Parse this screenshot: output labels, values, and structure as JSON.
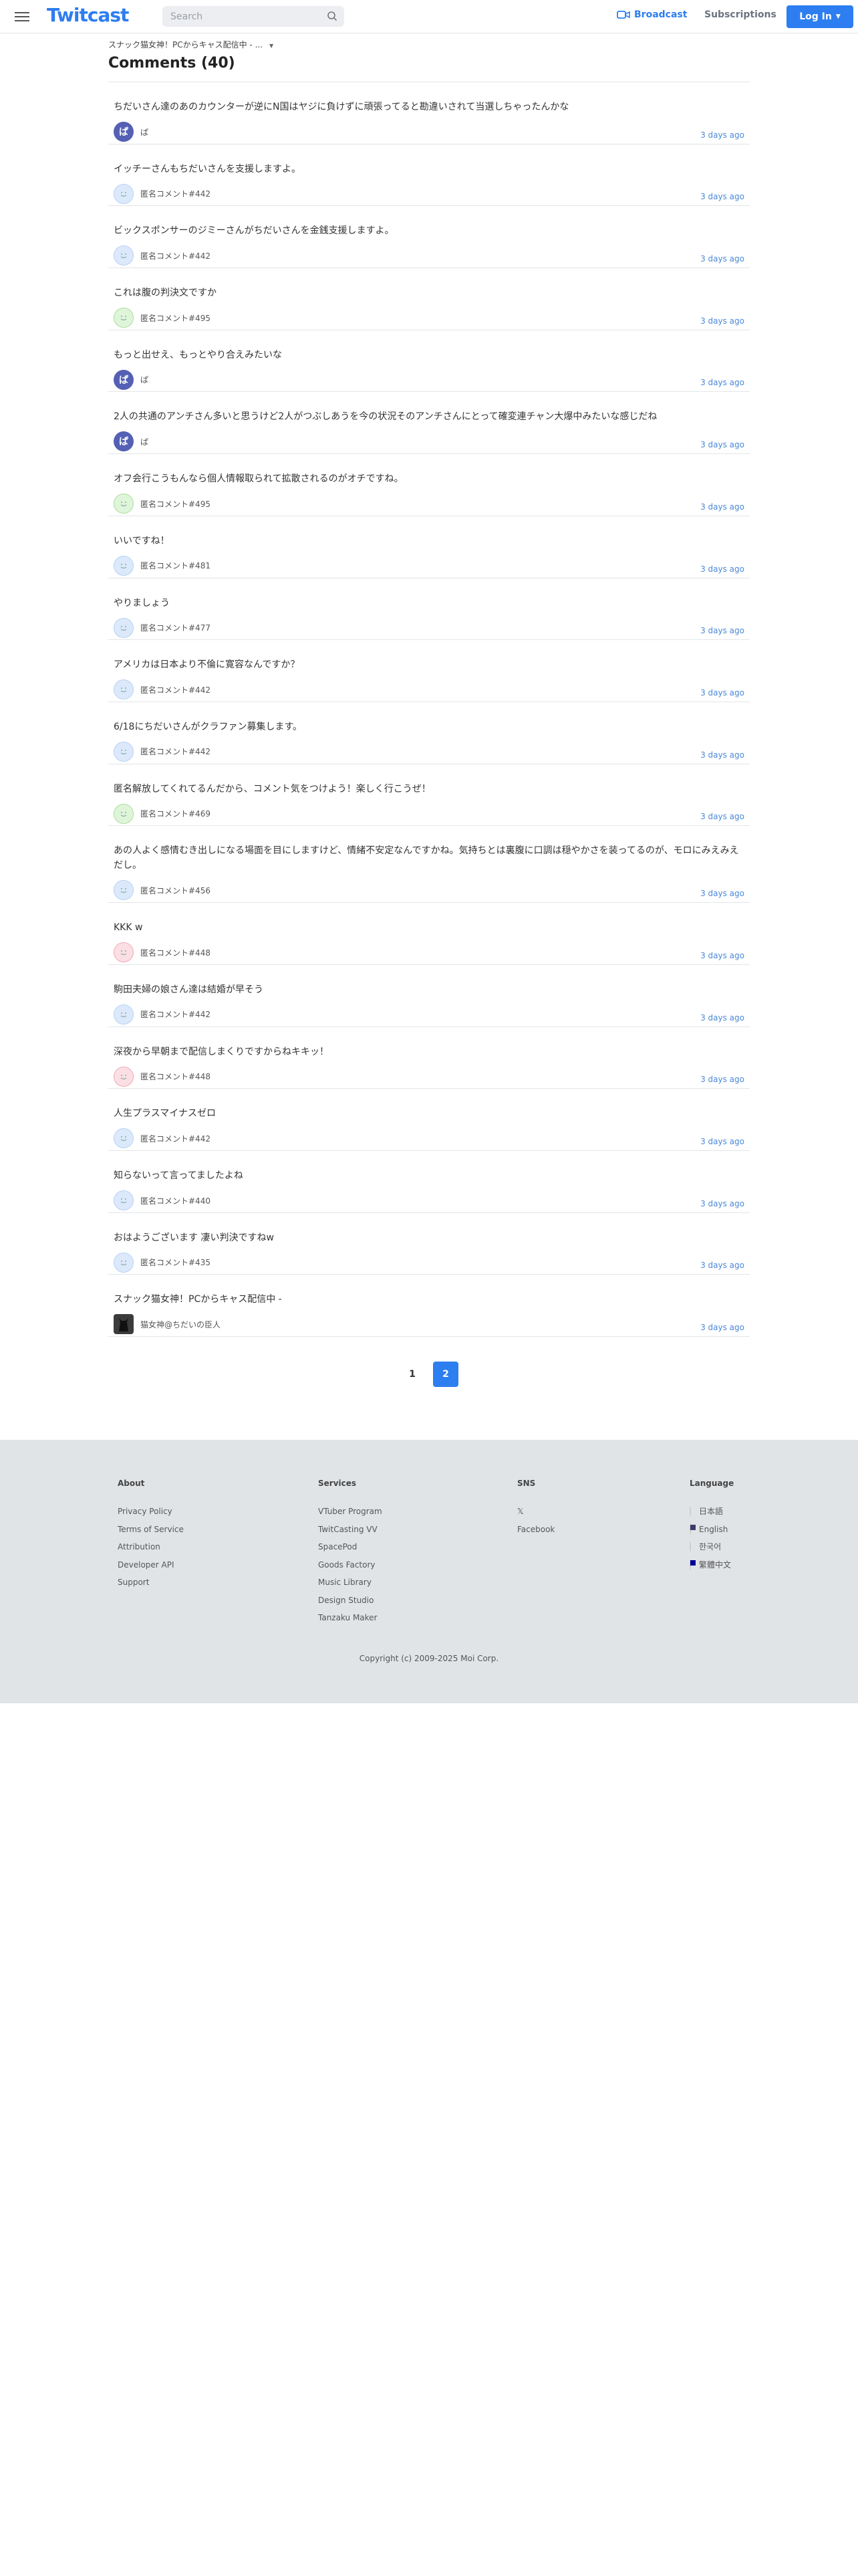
{
  "header": {
    "logo": "Twitcast",
    "search_placeholder": "Search",
    "broadcast_label": "Broadcast",
    "subscriptions_label": "Subscriptions",
    "login_label": "Log In"
  },
  "breadcrumb": "スナック猫女神！PCからキャス配信中 - ...",
  "page_title": "Comments (40)",
  "comments": [
    {
      "text": "ちだいさん達のあのカウンターが逆にN国はヤジに負けずに頑張ってると勘違いされて当選しちゃったんかな",
      "name": "ぱ",
      "time": "3 days ago",
      "avatar": "purple",
      "avatar_text": "ぱ"
    },
    {
      "text": "イッチーさんもちだいさんを支援しますよ。",
      "name": "匿名コメント#442",
      "time": "3 days ago",
      "avatar": "blue",
      "avatar_text": ""
    },
    {
      "text": "ビックスポンサーのジミーさんがちだいさんを金銭支援しますよ。",
      "name": "匿名コメント#442",
      "time": "3 days ago",
      "avatar": "blue",
      "avatar_text": ""
    },
    {
      "text": "これは腹の判決文ですか",
      "name": "匿名コメント#495",
      "time": "3 days ago",
      "avatar": "green",
      "avatar_text": ""
    },
    {
      "text": "もっと出せえ、もっとやり合えみたいな",
      "name": "ぱ",
      "time": "3 days ago",
      "avatar": "purple",
      "avatar_text": "ぱ"
    },
    {
      "text": "2人の共通のアンチさん多いと思うけど2人がつぶしあうを今の状況そのアンチさんにとって確変連チャン大爆中みたいな感じだね",
      "name": "ぱ",
      "time": "3 days ago",
      "avatar": "purple",
      "avatar_text": "ぱ"
    },
    {
      "text": "オフ会行こうもんなら個人情報取られて拡散されるのがオチですね。",
      "name": "匿名コメント#495",
      "time": "3 days ago",
      "avatar": "green",
      "avatar_text": ""
    },
    {
      "text": "いいですね！",
      "name": "匿名コメント#481",
      "time": "3 days ago",
      "avatar": "blue",
      "avatar_text": ""
    },
    {
      "text": "やりましょう",
      "name": "匿名コメント#477",
      "time": "3 days ago",
      "avatar": "blue",
      "avatar_text": ""
    },
    {
      "text": "アメリカは日本より不倫に寛容なんですか？",
      "name": "匿名コメント#442",
      "time": "3 days ago",
      "avatar": "blue",
      "avatar_text": ""
    },
    {
      "text": "6/18にちだいさんがクラファン募集します。",
      "name": "匿名コメント#442",
      "time": "3 days ago",
      "avatar": "blue",
      "avatar_text": ""
    },
    {
      "text": "匿名解放してくれてるんだから、コメント気をつけよう！楽しく行こうぜ！",
      "name": "匿名コメント#469",
      "time": "3 days ago",
      "avatar": "green",
      "avatar_text": ""
    },
    {
      "text": "あの人よく感情むき出しになる場面を目にしますけど、情緒不安定なんですかね。気持ちとは裏腹に口調は穏やかさを装ってるのが、モロにみえみえだし。",
      "name": "匿名コメント#456",
      "time": "3 days ago",
      "avatar": "blue",
      "avatar_text": ""
    },
    {
      "text": "KKK w",
      "name": "匿名コメント#448",
      "time": "3 days ago",
      "avatar": "pink",
      "avatar_text": ""
    },
    {
      "text": "駒田夫婦の娘さん達は結婚が早そう",
      "name": "匿名コメント#442",
      "time": "3 days ago",
      "avatar": "blue",
      "avatar_text": ""
    },
    {
      "text": "深夜から早朝まで配信しまくりですからねキキッ！",
      "name": "匿名コメント#448",
      "time": "3 days ago",
      "avatar": "pink",
      "avatar_text": ""
    },
    {
      "text": "人生プラスマイナスゼロ",
      "name": "匿名コメント#442",
      "time": "3 days ago",
      "avatar": "blue",
      "avatar_text": ""
    },
    {
      "text": "知らないって言ってましたよね",
      "name": "匿名コメント#440",
      "time": "3 days ago",
      "avatar": "blue",
      "avatar_text": ""
    },
    {
      "text": "おはようございます 凄い判決ですねw",
      "name": "匿名コメント#435",
      "time": "3 days ago",
      "avatar": "blue",
      "avatar_text": ""
    },
    {
      "text": "スナック猫女神！PCからキャス配信中 -",
      "name": "猫女神@ちだいの臣人",
      "time": "3 days ago",
      "avatar": "photo",
      "avatar_text": ""
    }
  ],
  "pagination": [
    "1",
    "2"
  ],
  "pagination_active": "2",
  "footer": {
    "about": {
      "heading": "About",
      "links": [
        "Privacy Policy",
        "Terms of Service",
        "Attribution",
        "Developer API",
        "Support"
      ]
    },
    "services": {
      "heading": "Services",
      "links": [
        "VTuber Program",
        "TwitCasting VV",
        "SpacePod",
        "Goods Factory",
        "Music Library",
        "Design Studio",
        "Tanzaku Maker"
      ]
    },
    "sns": {
      "heading": "SNS",
      "links": [
        "𝕏",
        "Facebook"
      ]
    },
    "language": {
      "heading": "Language",
      "links": [
        "日本語",
        "English",
        "한국어",
        "繁體中文"
      ]
    },
    "copyright": "Copyright (c) 2009-2025 Moi Corp."
  },
  "colors": {
    "accent": "#2d7ef0",
    "footer_bg": "#e1e4e7",
    "time": "#4a88d8"
  }
}
